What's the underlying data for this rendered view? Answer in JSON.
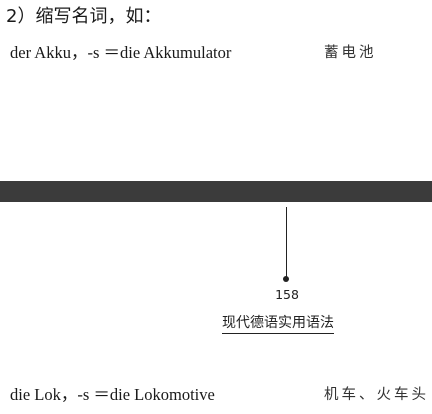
{
  "section": {
    "heading": "2）缩写名词，如："
  },
  "entries": [
    {
      "german": "der Akku，-s  ＝die Akkumulator",
      "chinese": "蓄电池"
    },
    {
      "german": "die Lok，-s   ＝die Lokomotive",
      "chinese": "机车、火车头"
    }
  ],
  "footer": {
    "page_number": "158",
    "book_title": "现代德语实用语法"
  }
}
